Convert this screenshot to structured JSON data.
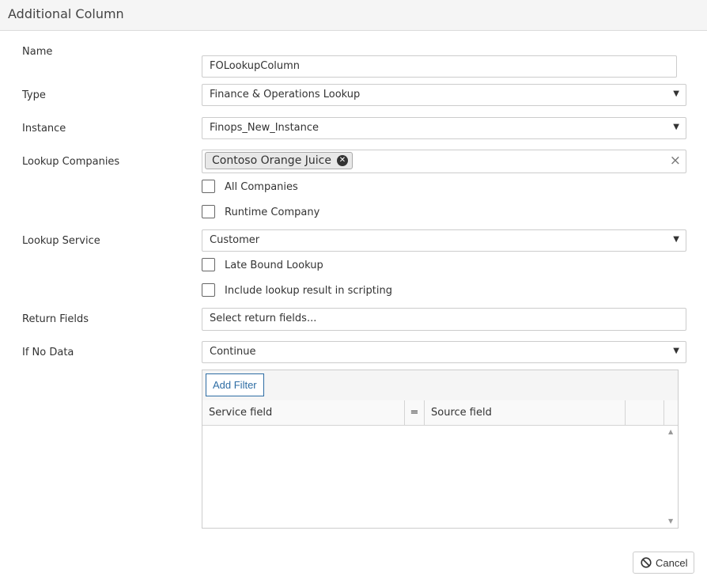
{
  "dialog": {
    "title": "Additional Column"
  },
  "form": {
    "name": {
      "label": "Name",
      "value": "FOLookupColumn"
    },
    "type": {
      "label": "Type",
      "value": "Finance & Operations Lookup"
    },
    "instance": {
      "label": "Instance",
      "value": "Finops_New_Instance"
    },
    "lookup_companies": {
      "label": "Lookup Companies",
      "selected": [
        "Contoso Orange Juice"
      ],
      "clear_glyph": "×",
      "chip_remove_glyph": "✕"
    },
    "all_companies": {
      "label": "All Companies",
      "checked": false
    },
    "runtime_company": {
      "label": "Runtime Company",
      "checked": false
    },
    "lookup_service": {
      "label": "Lookup Service",
      "value": "Customer"
    },
    "late_bound_lookup": {
      "label": "Late Bound Lookup",
      "checked": false
    },
    "include_in_scripting": {
      "label": "Include lookup result in scripting",
      "checked": false
    },
    "return_fields": {
      "label": "Return Fields",
      "placeholder": "Select return fields..."
    },
    "if_no_data": {
      "label": "If No Data",
      "value": "Continue"
    }
  },
  "filter_panel": {
    "add_filter_label": "Add Filter",
    "columns": [
      "Service field",
      "=",
      "Source field",
      ""
    ]
  },
  "footer": {
    "cancel_label": "Cancel"
  },
  "colors": {
    "accent": "#2e6da4",
    "border": "#cccccc",
    "header_bg": "#f5f5f5"
  }
}
